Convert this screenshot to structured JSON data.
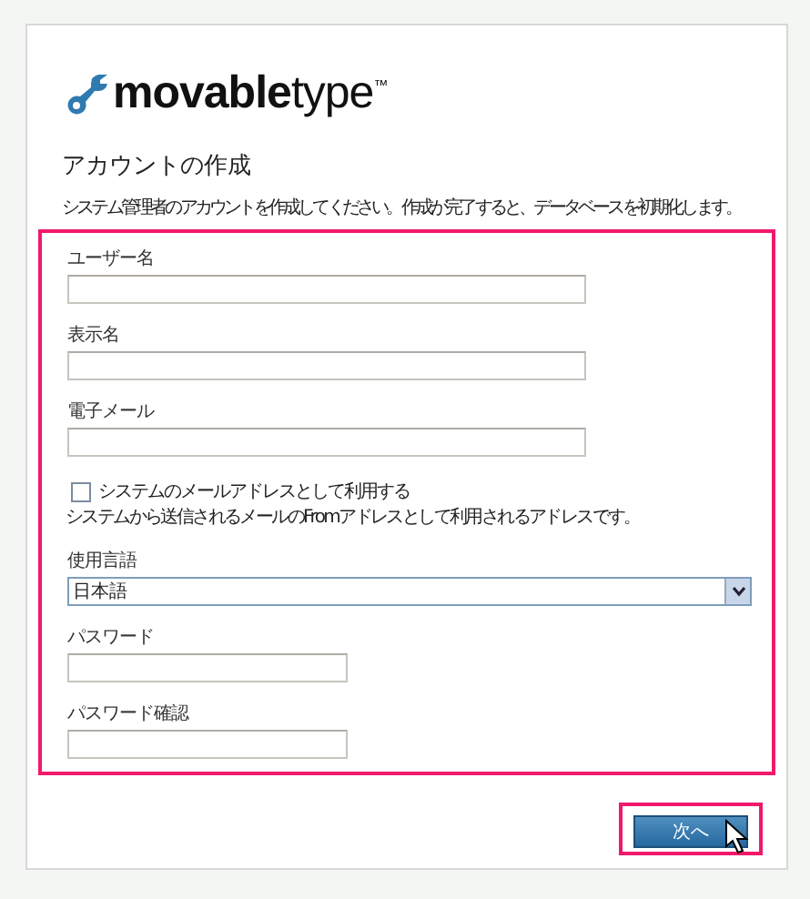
{
  "logo": {
    "text": "**movable**type$^{™}$"
  },
  "heading": "アカウントの作成",
  "intro": "システム管理者のアカウントを作成してください。作成が完了すると、データベースを初期化します。",
  "fields": [
    {
      "kind": "text",
      "label": "ユーザー名"
    },
    {
      "kind": "text",
      "label": "表示名"
    },
    {
      "kind": "text",
      "label": "電子メール"
    },
    {
      "kind": "checkbox",
      "label": "システムのメールアドレスとして利用する",
      "checked": false,
      "hint": "システムから送信されるメールのFromアドレスとして利用されるアドレスです。"
    },
    {
      "kind": "select",
      "label": "使用言語",
      "value": "日本語"
    },
    {
      "kind": "short",
      "label": "パスワード"
    },
    {
      "kind": "short",
      "label": "パスワード確認"
    }
  ],
  "next_button": {
    "label": "次へ"
  }
}
